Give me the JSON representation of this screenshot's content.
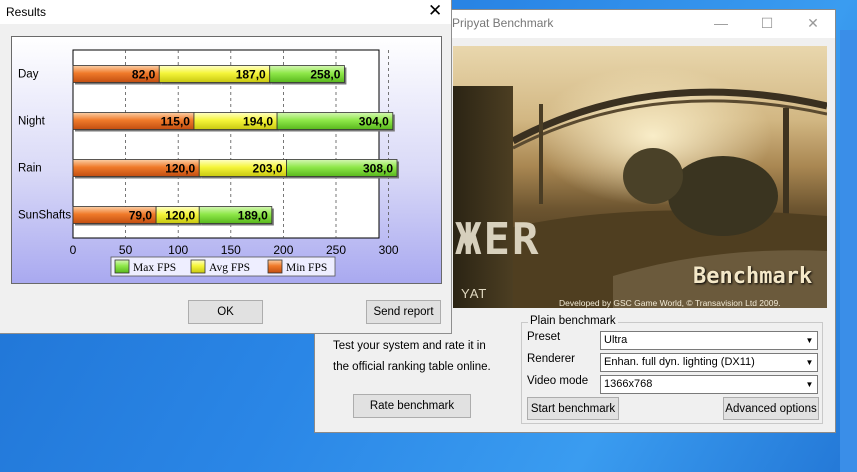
{
  "main_window": {
    "title": "Pripyat Benchmark",
    "controls": {
      "minimize": "—",
      "maximize": "☐",
      "close": "✕"
    },
    "art": {
      "logo": "S.T.A.L.K.E.R.",
      "logo_visible": "ЖЕR",
      "subtitle_fragment": "YAT",
      "benchmark_label": "Benchmark",
      "developer_text": "Developed by GSC Game World, © Transavision Ltd 2009."
    },
    "left_panel": {
      "description": "Test your system and rate it in the official ranking table online.",
      "rate_button": "Rate benchmark"
    },
    "plain_benchmark": {
      "legend": "Plain benchmark",
      "preset_label": "Preset",
      "preset_value": "Ultra",
      "renderer_label": "Renderer",
      "renderer_value": "Enhan. full dyn. lighting (DX11)",
      "video_mode_label": "Video mode",
      "video_mode_value": "1366x768",
      "start_button": "Start benchmark",
      "advanced_button": "Advanced options"
    }
  },
  "results_dialog": {
    "title": "Results",
    "close_icon": "✕",
    "ok_button": "OK",
    "send_button": "Send report"
  },
  "chart_data": {
    "type": "bar",
    "orientation": "horizontal",
    "stacked": true,
    "categories": [
      "Day",
      "Night",
      "Rain",
      "SunShafts"
    ],
    "series": [
      {
        "name": "Min FPS",
        "values": [
          82.0,
          115.0,
          120.0,
          79.0
        ],
        "color": "#f07a2a"
      },
      {
        "name": "Avg FPS",
        "values": [
          187.0,
          194.0,
          203.0,
          120.0
        ],
        "color": "#f5f53a"
      },
      {
        "name": "Max FPS",
        "values": [
          258.0,
          304.0,
          308.0,
          189.0
        ],
        "color": "#8fe84a"
      }
    ],
    "value_labels": [
      [
        "82,0",
        "187,0",
        "258,0"
      ],
      [
        "115,0",
        "194,0",
        "304,0"
      ],
      [
        "120,0",
        "203,0",
        "308,0"
      ],
      [
        "79,0",
        "120,0",
        "189,0"
      ]
    ],
    "xticks": [
      "0",
      "50",
      "100",
      "150",
      "200",
      "250",
      "300"
    ],
    "xlim": [
      0,
      350
    ],
    "grid": true,
    "legend_position": "bottom",
    "legend_order": [
      "Max FPS",
      "Avg FPS",
      "Min FPS"
    ]
  }
}
